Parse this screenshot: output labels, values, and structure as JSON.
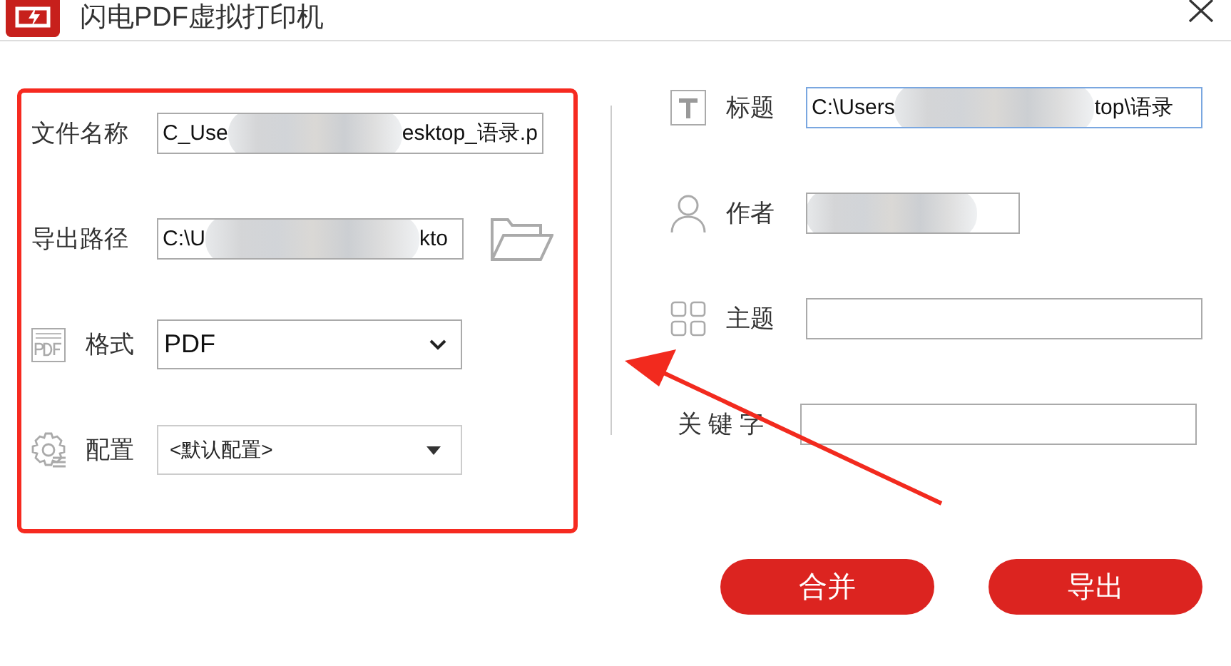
{
  "window": {
    "title": "闪电PDF虚拟打印机"
  },
  "left_fields": [
    {
      "kind": "filename",
      "label": "文件名称",
      "value_start": "C_Use",
      "value_end": "esktop_语录.p",
      "redacted": true
    },
    {
      "kind": "path",
      "label": "导出路径",
      "value_start": "C:\\U",
      "value_end": "kto",
      "redacted": true
    },
    {
      "kind": "format",
      "label": "格式",
      "value": "PDF"
    },
    {
      "kind": "config",
      "label": "配置",
      "value": "<默认配置>"
    }
  ],
  "right_fields": [
    {
      "kind": "title",
      "label": "标题",
      "value_start": "C:\\Users",
      "value_end": "top\\语录",
      "redacted": true,
      "focused": true
    },
    {
      "kind": "author",
      "label": "作者",
      "redacted": true,
      "focused": false
    },
    {
      "kind": "subject",
      "label": "主题",
      "redacted": false,
      "focused": false
    },
    {
      "kind": "keywords",
      "label": "关 键 字",
      "redacted": false,
      "focused": false
    }
  ],
  "buttons": [
    "合并",
    "导出"
  ]
}
